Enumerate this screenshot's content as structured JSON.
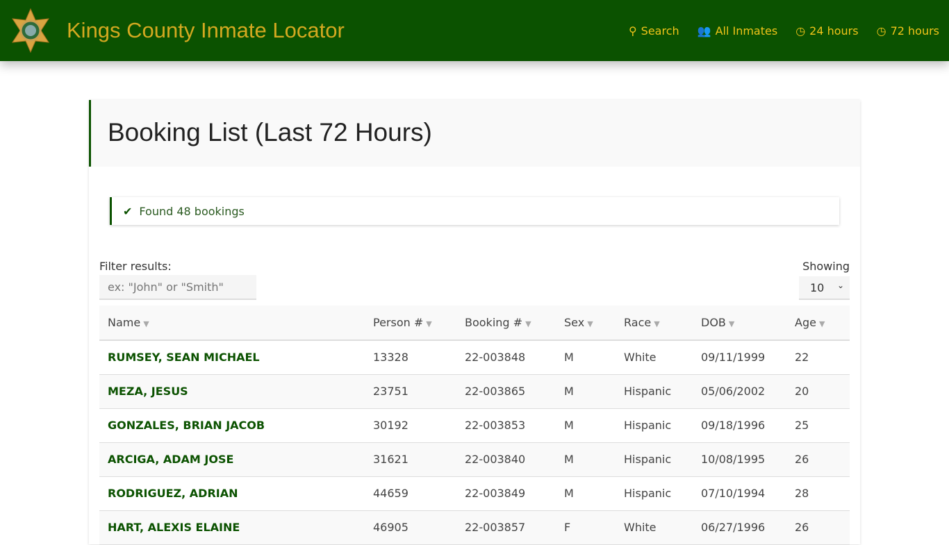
{
  "header": {
    "title": "Kings County Inmate Locator",
    "nav": [
      {
        "icon": "search-icon",
        "glyph": "⚲",
        "label": "Search"
      },
      {
        "icon": "users-icon",
        "glyph": "👥",
        "label": "All Inmates"
      },
      {
        "icon": "clock-icon",
        "glyph": "◷",
        "label": "24 hours"
      },
      {
        "icon": "clock-icon",
        "glyph": "◷",
        "label": "72 hours"
      }
    ]
  },
  "page": {
    "title": "Booking List (Last 72 Hours)",
    "alert": "Found 48 bookings",
    "filter_label": "Filter results:",
    "filter_placeholder": "ex: \"John\" or \"Smith\"",
    "showing_label": "Showing",
    "showing_value": "10"
  },
  "table": {
    "columns": [
      "Name",
      "Person #",
      "Booking #",
      "Sex",
      "Race",
      "DOB",
      "Age"
    ],
    "rows": [
      [
        "RUMSEY, SEAN MICHAEL",
        "13328",
        "22-003848",
        "M",
        "White",
        "09/11/1999",
        "22"
      ],
      [
        "MEZA, JESUS",
        "23751",
        "22-003865",
        "M",
        "Hispanic",
        "05/06/2002",
        "20"
      ],
      [
        "GONZALES, BRIAN JACOB",
        "30192",
        "22-003853",
        "M",
        "Hispanic",
        "09/18/1996",
        "25"
      ],
      [
        "ARCIGA, ADAM JOSE",
        "31621",
        "22-003840",
        "M",
        "Hispanic",
        "10/08/1995",
        "26"
      ],
      [
        "RODRIGUEZ, ADRIAN",
        "44659",
        "22-003849",
        "M",
        "Hispanic",
        "07/10/1994",
        "28"
      ],
      [
        "HART, ALEXIS ELAINE",
        "46905",
        "22-003857",
        "F",
        "White",
        "06/27/1996",
        "26"
      ]
    ]
  },
  "colors": {
    "brand": "#0b5200",
    "title_gold": "#d4a920",
    "nav_yellow": "#f0c419"
  }
}
